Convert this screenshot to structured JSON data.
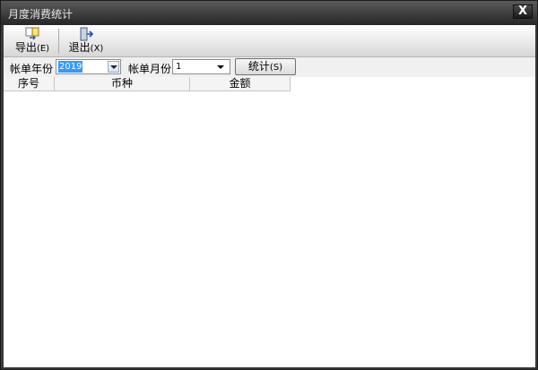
{
  "window": {
    "title": "月度消费统计",
    "close_label": "X"
  },
  "toolbar": {
    "export": {
      "label": "导出",
      "shortcut": "(E)",
      "icon": "export-icon"
    },
    "exit": {
      "label": "退出",
      "shortcut": "(X)",
      "icon": "exit-icon"
    }
  },
  "filters": {
    "year_label": "帐单年份",
    "year_value": "2019",
    "month_label": "帐单月份",
    "month_value": "1",
    "stat_button": "统计",
    "stat_shortcut": "(S)"
  },
  "grid": {
    "columns": [
      "序号",
      "币种",
      "金额"
    ],
    "rows": []
  },
  "colors": {
    "selection": "#3399ff",
    "titlebar": "#262626"
  }
}
